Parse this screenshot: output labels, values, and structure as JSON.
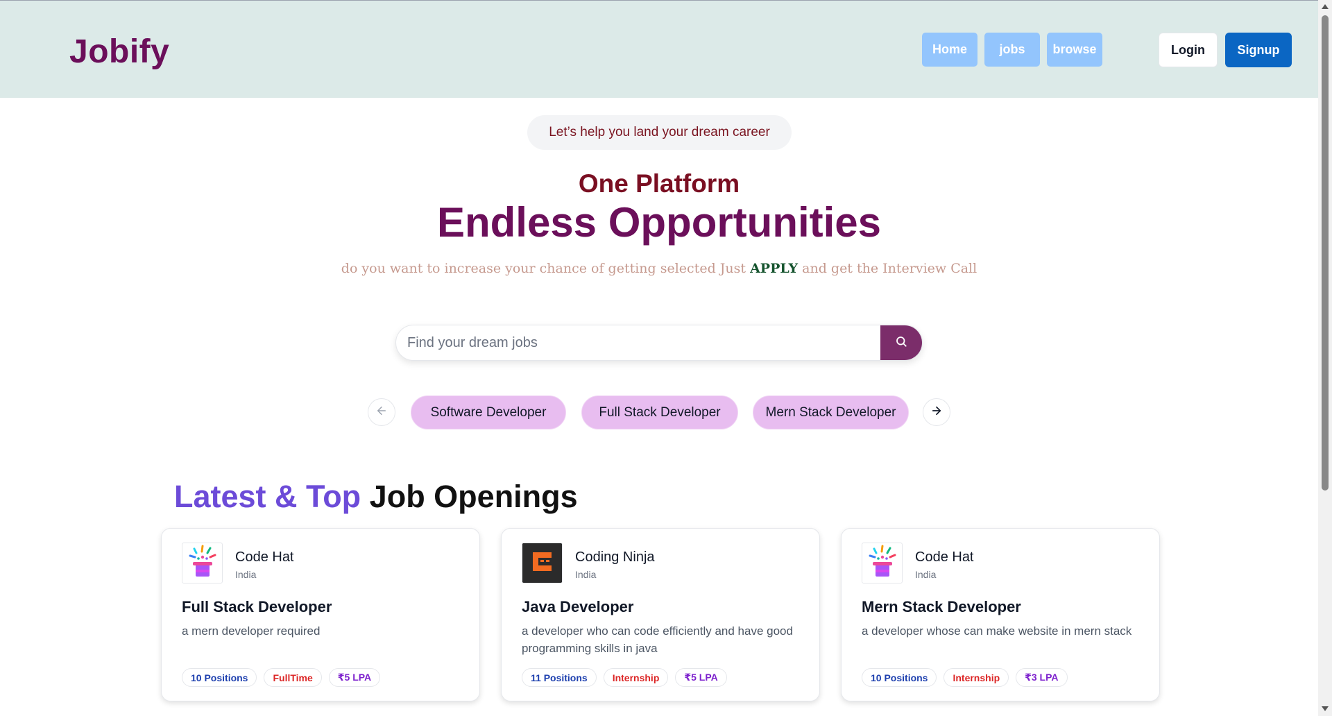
{
  "navbar": {
    "brand": "Jobify",
    "links": [
      {
        "label": "Home"
      },
      {
        "label": "jobs"
      },
      {
        "label": "browse"
      }
    ],
    "login_label": "Login",
    "signup_label": "Signup"
  },
  "hero": {
    "tagline": "Let’s help you land your dream career",
    "subtitle": "One Platform",
    "title": "Endless Opportunities",
    "desc_before": "do you want to increase your chance of getting selected Just ",
    "desc_emphasis": "APPLY",
    "desc_after": " and get the Interview Call"
  },
  "search": {
    "placeholder": "Find your dream jobs",
    "icon": "search-icon"
  },
  "categories": {
    "items": [
      "Software Developer",
      "Full Stack Developer",
      "Mern Stack Developer"
    ],
    "prev_icon": "arrow-left-icon",
    "next_icon": "arrow-right-icon"
  },
  "section": {
    "title_accent": "Latest & Top",
    "title_rest": " Job Openings"
  },
  "jobs": [
    {
      "company": "Code Hat",
      "country": "India",
      "logo": "code-hat-logo",
      "role": "Full Stack Developer",
      "description": "a mern developer required",
      "positions": "10 Positions",
      "type": "FullTime",
      "salary": "₹5 LPA"
    },
    {
      "company": "Coding Ninja",
      "country": "India",
      "logo": "coding-ninja-logo",
      "role": "Java Developer",
      "description": "a developer who can code efficiently and have good programming skills in java",
      "positions": "11 Positions",
      "type": "Internship",
      "salary": "₹5 LPA"
    },
    {
      "company": "Code Hat",
      "country": "India",
      "logo": "code-hat-logo",
      "role": "Mern Stack Developer",
      "description": "a developer whose can make website in mern stack",
      "positions": "10 Positions",
      "type": "Internship",
      "salary": "₹3 LPA"
    }
  ],
  "colors": {
    "brand": "#6b0f5a",
    "navbar_bg": "#dceae8",
    "nav_link_bg": "#93c5fd",
    "signup_bg": "#0b66c3",
    "search_button_bg": "#7b2d6a",
    "chip_bg": "#e8bdf0",
    "accent_purple": "#6c4bd8"
  }
}
